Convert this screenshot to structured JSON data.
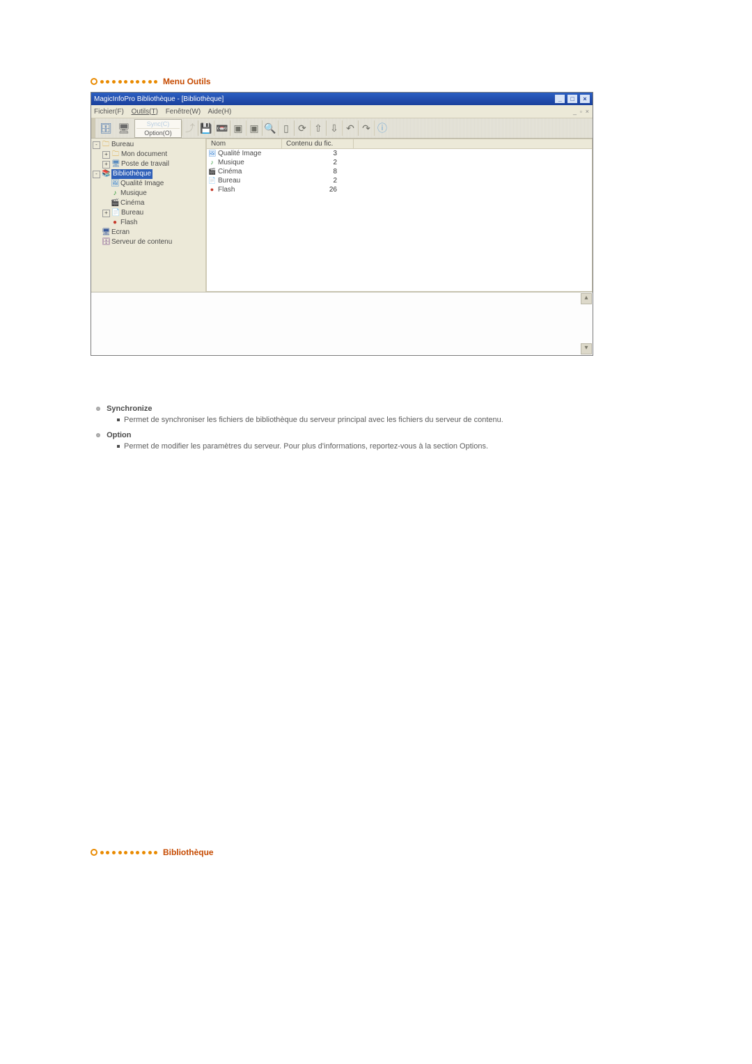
{
  "section1": {
    "title": "Menu Outils"
  },
  "section2": {
    "title": "Bibliothèque"
  },
  "window": {
    "title": "MagicInfoPro Bibliothèque - [Bibliothèque]",
    "menus": {
      "file": "Fichier(F)",
      "tools": "Outils(T)",
      "window": "Fenêtre(W)",
      "help": "Aide(H)"
    },
    "dropdown": {
      "sync": "Sync(C)",
      "option": "Option(O)"
    }
  },
  "tree": {
    "bureau": "Bureau",
    "monDoc": "Mon document",
    "poste": "Poste de travail",
    "biblio": "Bibliothèque",
    "qi": "Qualité Image",
    "musique": "Musique",
    "cinema": "Cinéma",
    "bureau2": "Bureau",
    "flash": "Flash",
    "ecran": "Ecran",
    "serveur": "Serveur de contenu"
  },
  "list": {
    "head": {
      "name": "Nom",
      "count": "Contenu du fic."
    },
    "rows": [
      {
        "icon": "🖼",
        "iconColor": "#2e7dd1",
        "name": "Qualité Image",
        "count": "3"
      },
      {
        "icon": "♪",
        "iconColor": "#2e9a36",
        "name": "Musique",
        "count": "2"
      },
      {
        "icon": "🎬",
        "iconColor": "#8a5a2b",
        "name": "Cinéma",
        "count": "8"
      },
      {
        "icon": "📄",
        "iconColor": "#4a8a5a",
        "name": "Bureau",
        "count": "2"
      },
      {
        "icon": "●",
        "iconColor": "#c63a2b",
        "name": "Flash",
        "count": "26"
      }
    ]
  },
  "expl": {
    "sync": {
      "term": "Synchronize",
      "desc": "Permet de synchroniser les fichiers de bibliothèque du serveur principal avec les fichiers du serveur de contenu."
    },
    "option": {
      "term": "Option",
      "desc": "Permet de modifier les paramètres du serveur. Pour plus d'informations, reportez-vous à la section Options."
    }
  }
}
